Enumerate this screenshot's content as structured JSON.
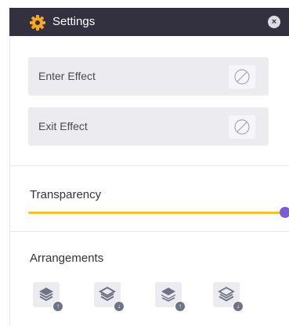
{
  "header": {
    "title": "Settings",
    "icon": "gear-icon",
    "close_glyph": "×",
    "accent_color": "#f5a623",
    "background_color": "#33313f"
  },
  "effects": {
    "enter_label": "Enter Effect",
    "exit_label": "Exit Effect",
    "none_icon": "no-effect-icon"
  },
  "transparency": {
    "label": "Transparency",
    "value_fraction": 1.0,
    "track_color": "#f2c230",
    "thumb_color": "#7b5cd6"
  },
  "arrangements": {
    "label": "Arrangements",
    "buttons": [
      {
        "name": "bring-forward",
        "icon": "layers-icon",
        "badge": "↑"
      },
      {
        "name": "send-backward",
        "icon": "layers-icon",
        "badge": "↓"
      },
      {
        "name": "bring-to-front",
        "icon": "layers-icon",
        "badge": "↑"
      },
      {
        "name": "send-to-back",
        "icon": "layers-icon",
        "badge": "↓"
      }
    ]
  }
}
